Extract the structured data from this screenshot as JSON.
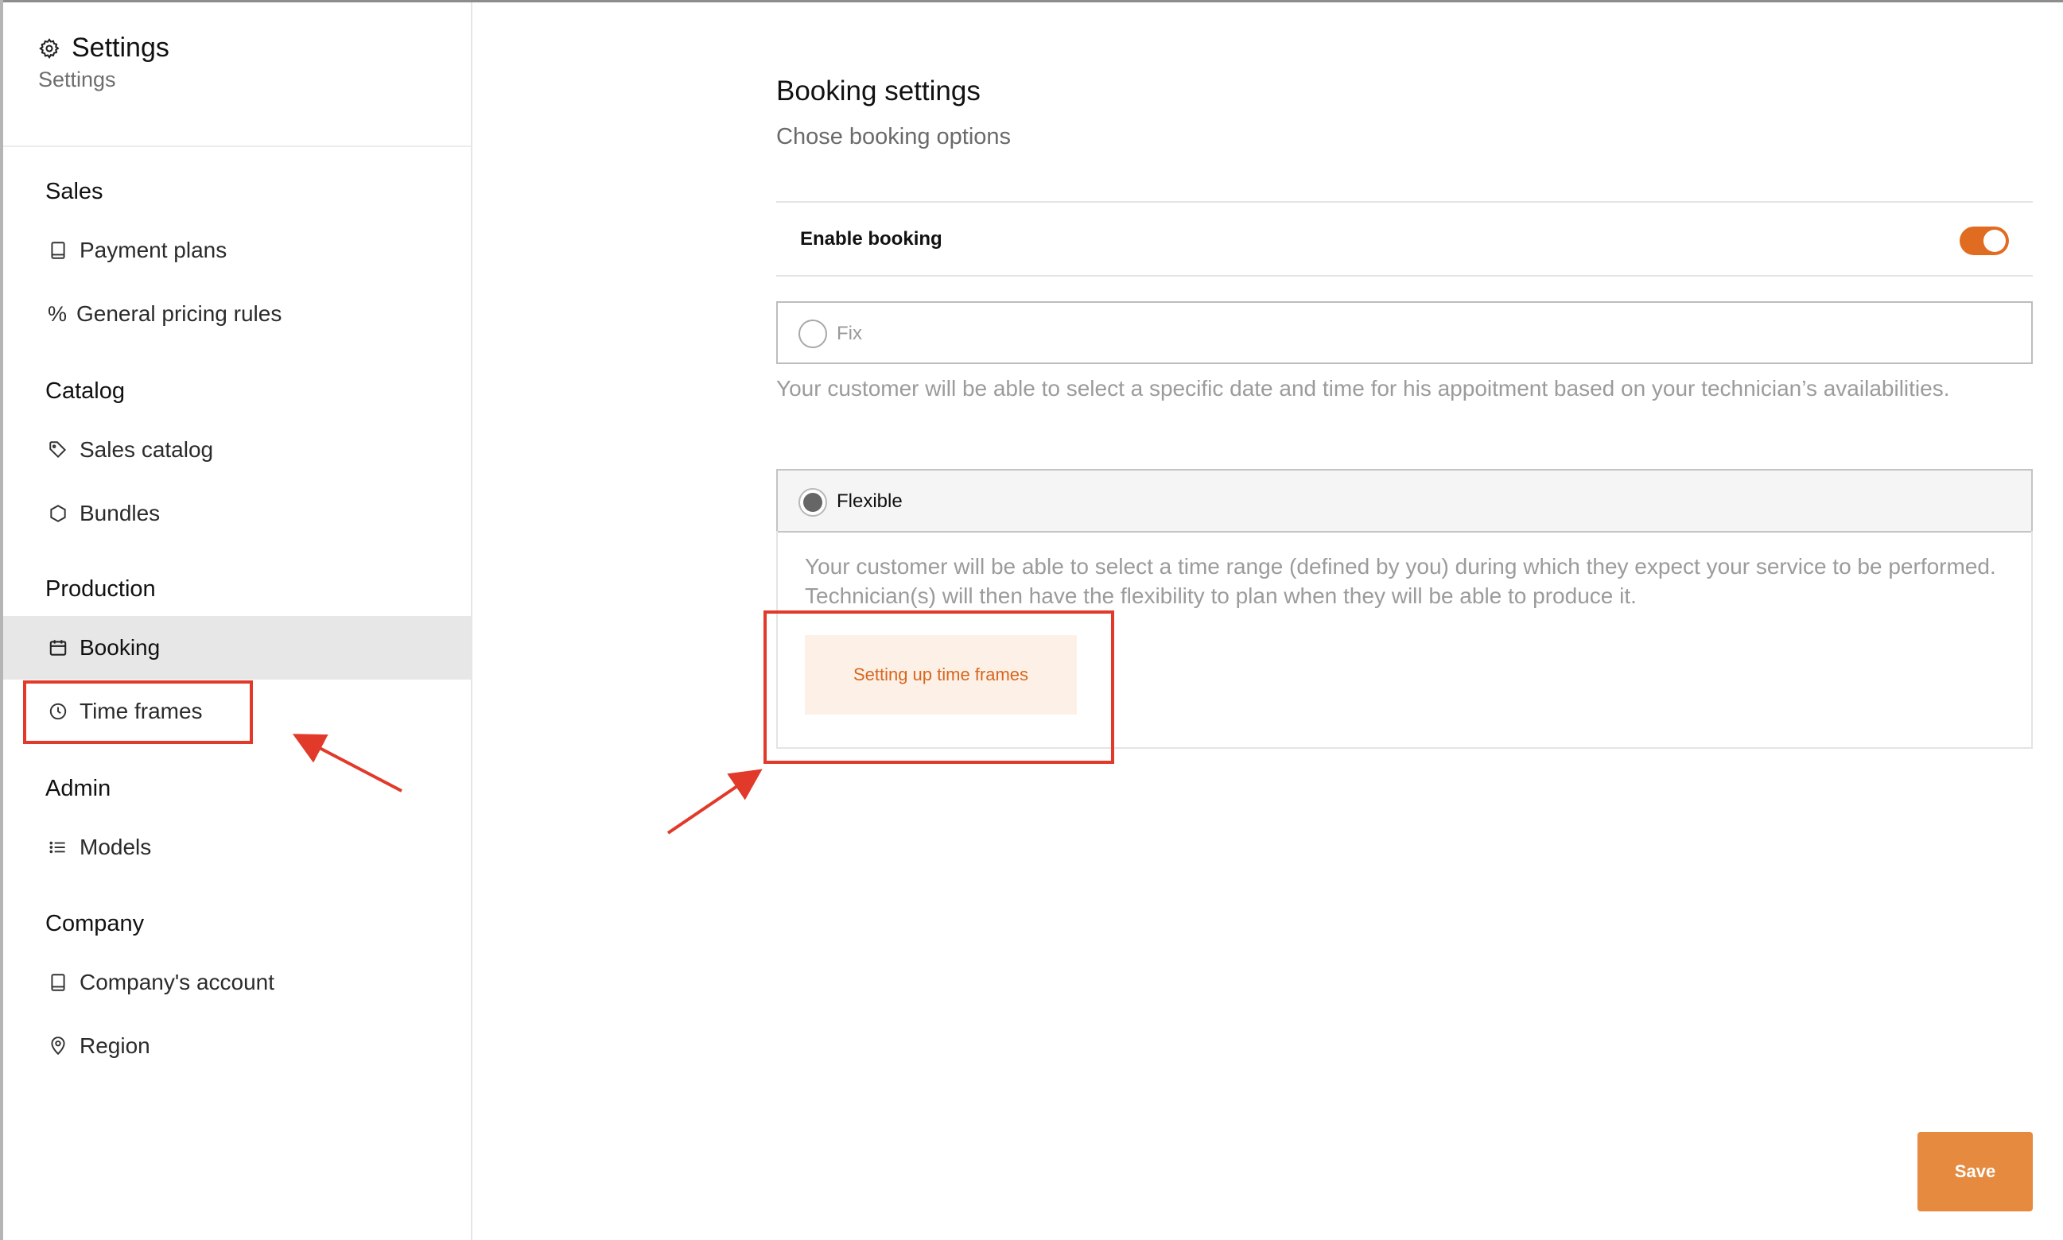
{
  "sidebar": {
    "title": "Settings",
    "subtitle": "Settings",
    "sections": {
      "sales": {
        "heading": "Sales",
        "items": [
          {
            "label": "Payment plans",
            "icon": "book-icon"
          },
          {
            "label": "General pricing rules",
            "icon": "percent-icon",
            "glyph": "%"
          }
        ]
      },
      "catalog": {
        "heading": "Catalog",
        "items": [
          {
            "label": "Sales catalog",
            "icon": "tag-icon"
          },
          {
            "label": "Bundles",
            "icon": "hexagon-icon"
          }
        ]
      },
      "production": {
        "heading": "Production",
        "items": [
          {
            "label": "Booking",
            "icon": "calendar-icon",
            "active": true
          },
          {
            "label": "Time frames",
            "icon": "clock-icon"
          }
        ]
      },
      "admin": {
        "heading": "Admin",
        "items": [
          {
            "label": "Models",
            "icon": "list-icon"
          }
        ]
      },
      "company": {
        "heading": "Company",
        "items": [
          {
            "label": "Company's account",
            "icon": "book-icon"
          },
          {
            "label": "Region",
            "icon": "map-pin-icon"
          }
        ]
      }
    }
  },
  "main": {
    "title": "Booking settings",
    "subtitle": "Chose booking options",
    "enable_booking": {
      "label": "Enable booking",
      "checked": true
    },
    "options": {
      "fix": {
        "label": "Fix",
        "selected": false,
        "description": "Your customer will be able to select a specific date and time for his appoitment based on your technician’s availabilities."
      },
      "flexible": {
        "label": "Flexible",
        "selected": true,
        "description": "Your customer will be able to select a time range (defined by you) during which they expect your service to be performed. Technician(s) will then have the flexibility to plan when they will be able to produce it.",
        "button_label": "Setting up time frames"
      }
    },
    "save_label": "Save"
  },
  "colors": {
    "accent": "#e06c21",
    "save_button": "#e58a3f",
    "secondary_button_bg": "#fdf0e7",
    "annotation_red": "#e1392a",
    "active_item_bg": "#e7e7e7"
  }
}
